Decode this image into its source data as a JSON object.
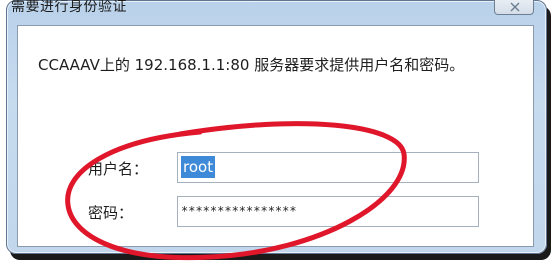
{
  "dialog": {
    "title": "需要进行身份验证",
    "close_glyph": "✕"
  },
  "message": {
    "text": "CCAAAV上的 192.168.1.1:80 服务器要求提供用户名和密码。"
  },
  "form": {
    "username_label": "用户名：",
    "username_value": "root",
    "password_label": "密码：",
    "password_value": "****************"
  },
  "colors": {
    "annotation_red": "#e0162b",
    "selection_blue": "#3f8ad8",
    "frame_blue": "#c2d6ec"
  },
  "icons": {
    "close": "close-icon"
  }
}
